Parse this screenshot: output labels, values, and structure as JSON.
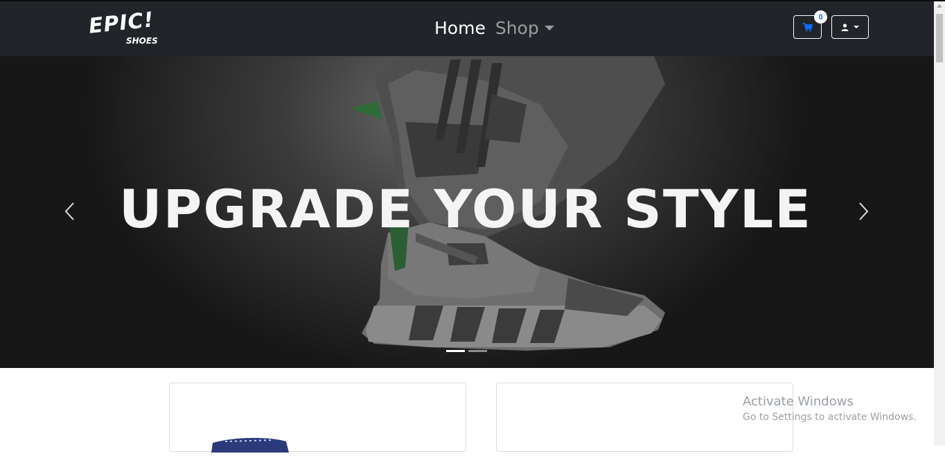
{
  "brand": {
    "name": "EPIC!",
    "tagline": "SHOES"
  },
  "nav": {
    "home_label": "Home",
    "shop_label": "Shop"
  },
  "cart": {
    "count": "0"
  },
  "hero": {
    "headline": "UPGRADE YOUR STYLE",
    "slides": 2,
    "active_slide": 1
  },
  "icons": {
    "cart": "cart-icon",
    "user": "user-icon",
    "prev": "chevron-left-icon",
    "next": "chevron-right-icon"
  },
  "colors": {
    "navbar": "#212529",
    "badge_text": "#0d6efd",
    "hero_bg": "#171717"
  },
  "watermark": {
    "title": "Activate Windows",
    "subtitle": "Go to Settings to activate Windows."
  }
}
